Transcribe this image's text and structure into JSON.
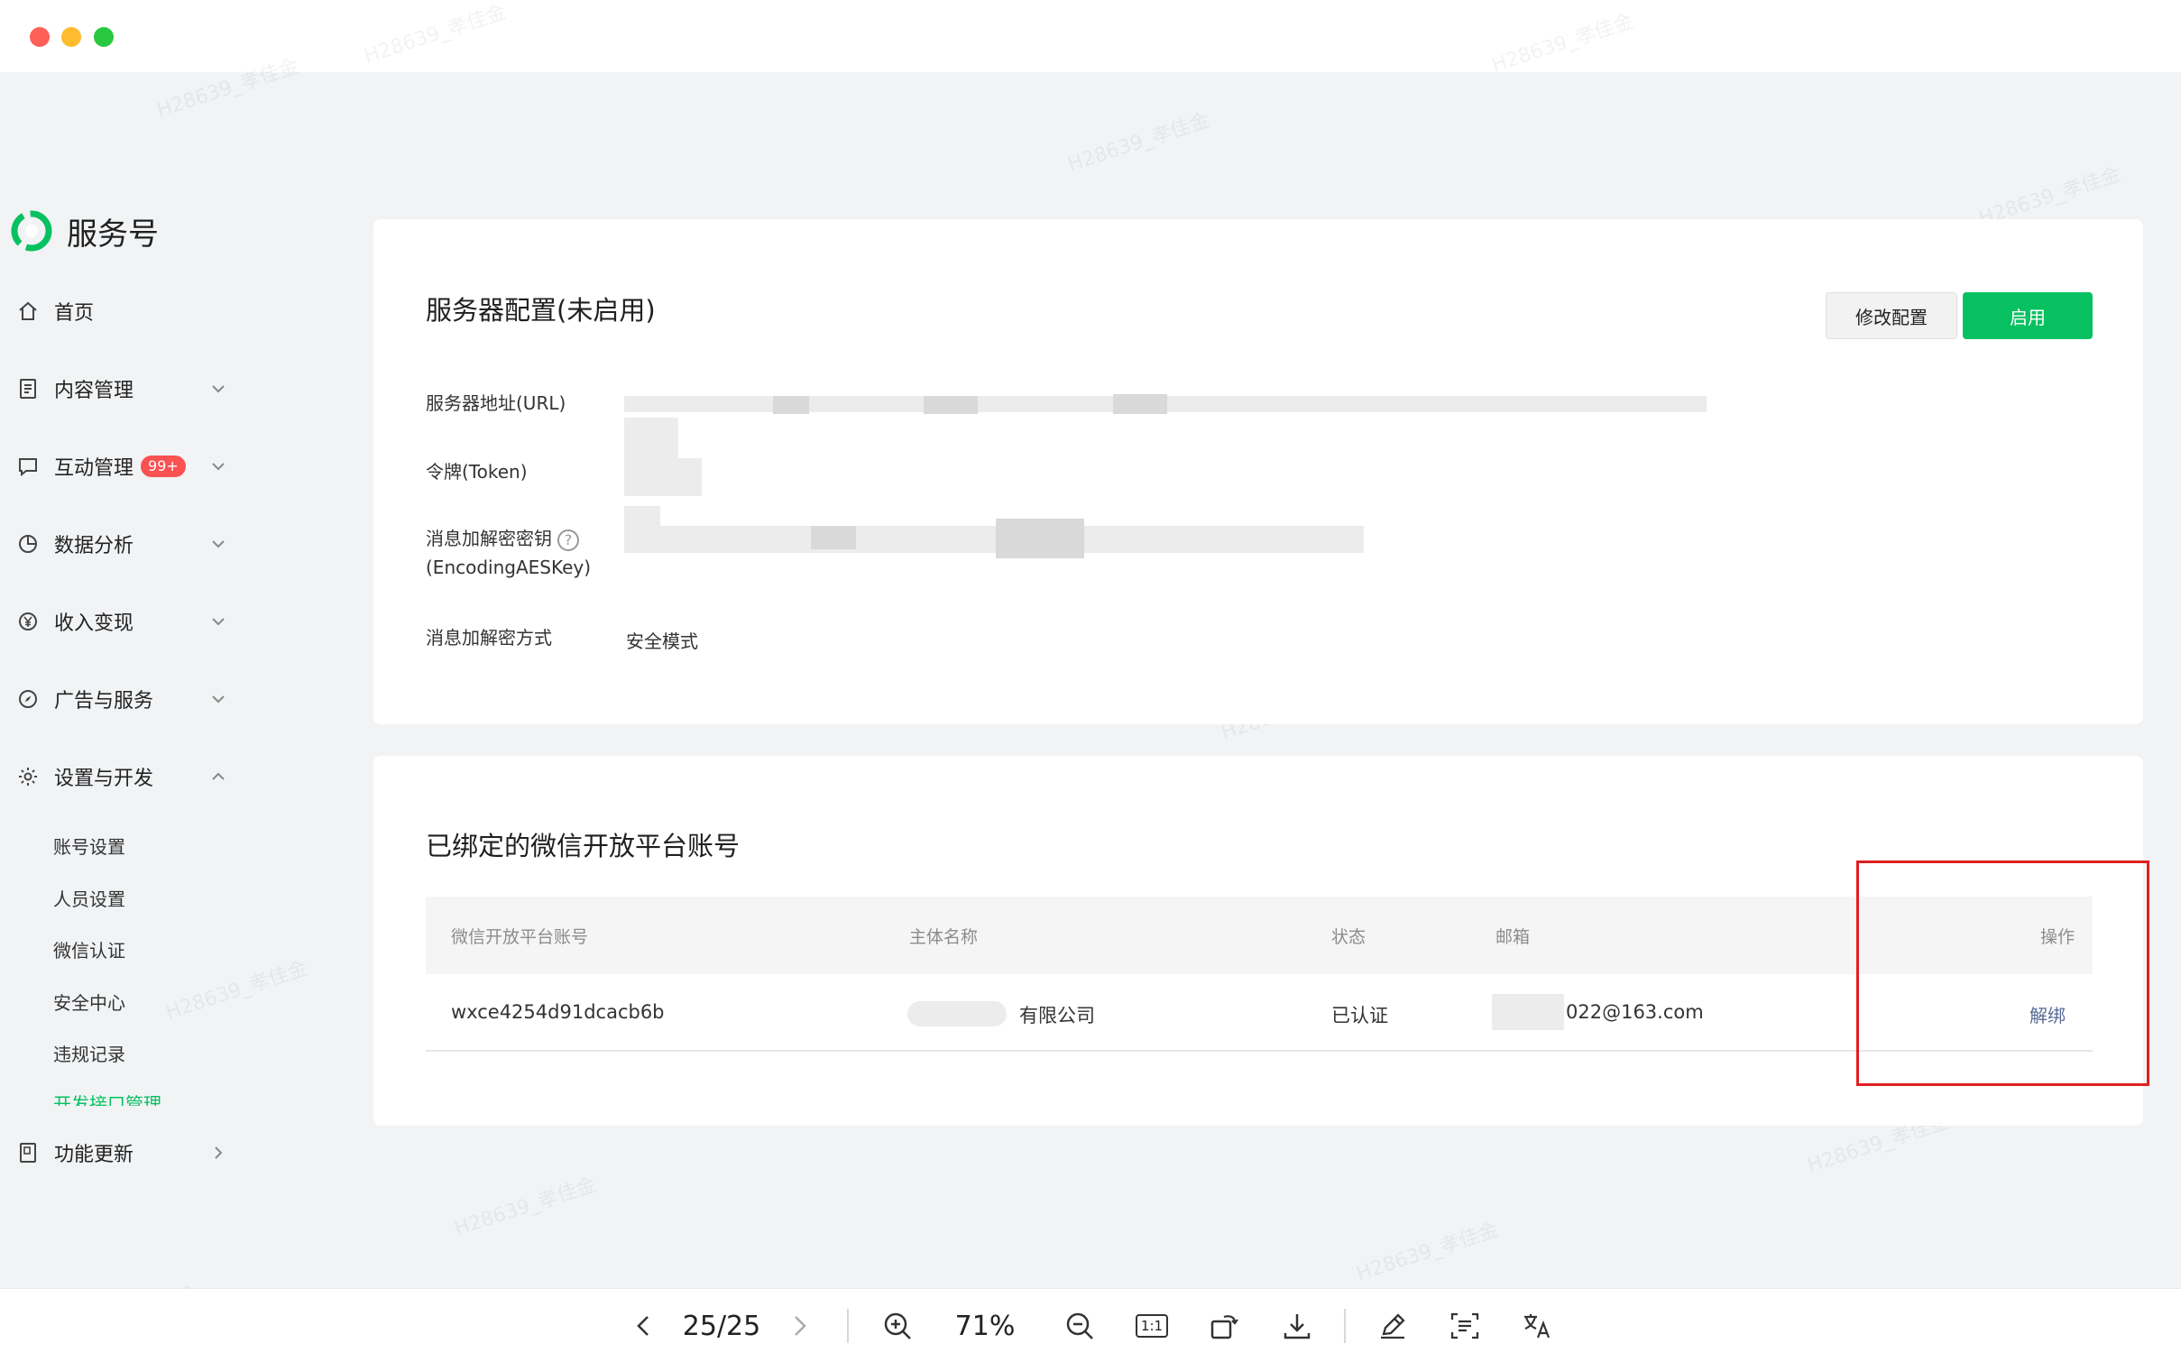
{
  "brand": {
    "name": "服务号"
  },
  "sidebar": {
    "items": [
      {
        "label": "首页",
        "icon": "home-icon"
      },
      {
        "label": "内容管理",
        "icon": "document-icon"
      },
      {
        "label": "互动管理",
        "icon": "chat-icon",
        "badge": "99+"
      },
      {
        "label": "数据分析",
        "icon": "pie-chart-icon"
      },
      {
        "label": "收入变现",
        "icon": "yen-icon"
      },
      {
        "label": "广告与服务",
        "icon": "compass-icon"
      },
      {
        "label": "设置与开发",
        "icon": "gear-icon"
      },
      {
        "label": "功能更新",
        "icon": "book-icon"
      }
    ],
    "sub_items": [
      "账号设置",
      "人员设置",
      "微信认证",
      "安全中心",
      "违规记录",
      "开发接口管理"
    ]
  },
  "server_config": {
    "title": "服务器配置(未启用)",
    "modify_button": "修改配置",
    "enable_button": "启用",
    "url_label": "服务器地址(URL)",
    "token_label": "令牌(Token)",
    "aes_label_line1": "消息加解密密钥",
    "aes_label_line2": "(EncodingAESKey)",
    "mode_label": "消息加解密方式",
    "mode_value": "安全模式"
  },
  "bound_accounts": {
    "title": "已绑定的微信开放平台账号",
    "columns": [
      "微信开放平台账号",
      "主体名称",
      "状态",
      "邮箱",
      "操作"
    ],
    "rows": [
      {
        "account": "wxce4254d91dcacb6b",
        "entity": "有限公司",
        "status": "已认证",
        "email": "022@163.com",
        "action": "解绑"
      }
    ]
  },
  "viewer_toolbar": {
    "page_indicator": "25/25",
    "zoom": "71%",
    "actual_size_label": "1:1"
  },
  "watermark": "H28639_孝佳金",
  "colors": {
    "primary_green": "#07c160",
    "badge_red": "#fa5151",
    "link_blue": "#576b95",
    "highlight_red": "#e02020"
  }
}
